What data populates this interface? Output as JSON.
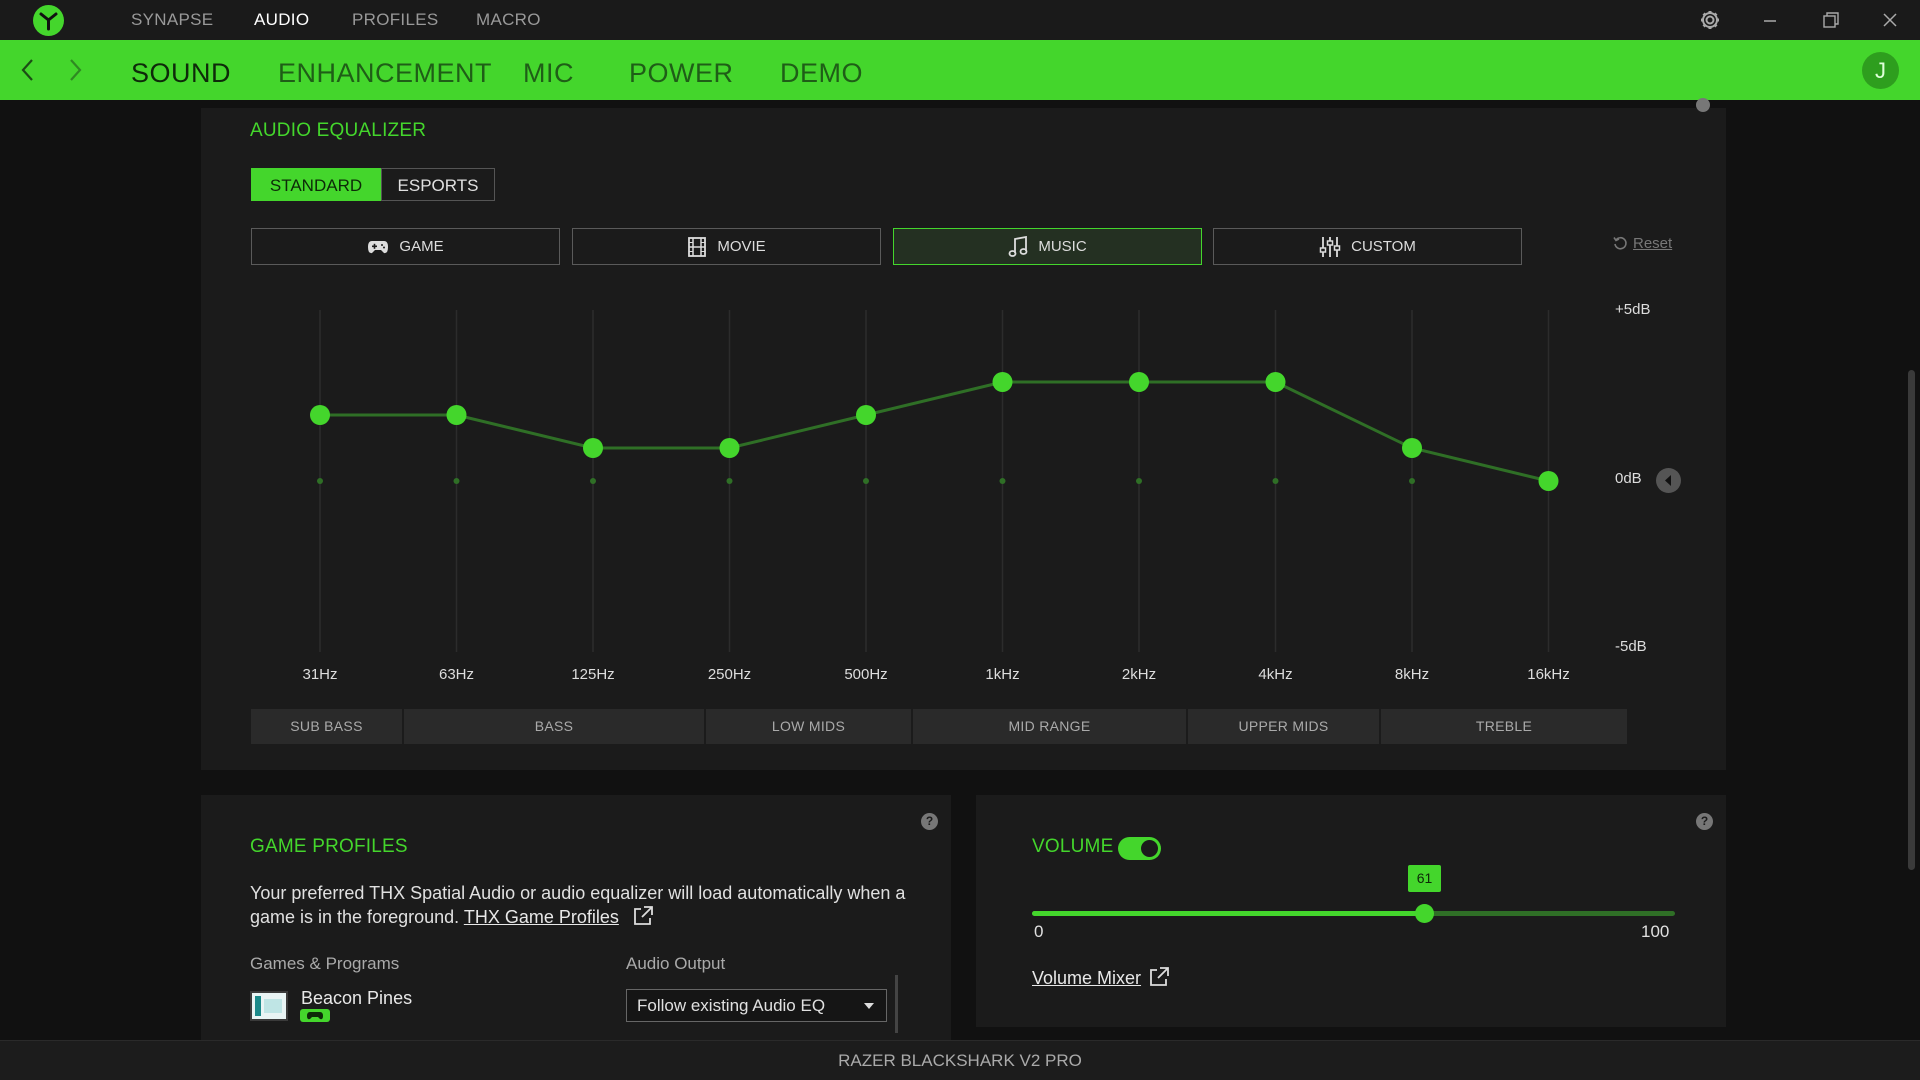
{
  "top_nav": [
    "SYNAPSE",
    "AUDIO",
    "PROFILES",
    "MACRO"
  ],
  "top_nav_active": "AUDIO",
  "tabs": [
    "SOUND",
    "ENHANCEMENT",
    "MIC",
    "POWER",
    "DEMO"
  ],
  "tabs_active": "SOUND",
  "user_initial": "J",
  "equalizer": {
    "title": "AUDIO EQUALIZER",
    "modes": [
      "STANDARD",
      "ESPORTS"
    ],
    "mode_active": "STANDARD",
    "presets": [
      {
        "label": "GAME",
        "icon": "gamepad-icon"
      },
      {
        "label": "MOVIE",
        "icon": "film-icon"
      },
      {
        "label": "MUSIC",
        "icon": "music-note-icon"
      },
      {
        "label": "CUSTOM",
        "icon": "sliders-icon"
      }
    ],
    "preset_active": "MUSIC",
    "reset_label": "Reset",
    "db_max_label": "+5dB",
    "db_mid_label": "0dB",
    "db_min_label": "-5dB",
    "bands": [
      {
        "freq": "31Hz",
        "gain": 2
      },
      {
        "freq": "63Hz",
        "gain": 2
      },
      {
        "freq": "125Hz",
        "gain": 1
      },
      {
        "freq": "250Hz",
        "gain": 1
      },
      {
        "freq": "500Hz",
        "gain": 2
      },
      {
        "freq": "1kHz",
        "gain": 3
      },
      {
        "freq": "2kHz",
        "gain": 3
      },
      {
        "freq": "4kHz",
        "gain": 3
      },
      {
        "freq": "8kHz",
        "gain": 1
      },
      {
        "freq": "16kHz",
        "gain": 0
      }
    ],
    "range_labels": [
      "SUB BASS",
      "BASS",
      "LOW MIDS",
      "MID RANGE",
      "UPPER MIDS",
      "TREBLE"
    ]
  },
  "game_profiles": {
    "title": "GAME PROFILES",
    "description": "Your preferred THX Spatial Audio or audio equalizer will load automatically when a game is in the foreground.",
    "link_label": "THX Game Profiles",
    "col_games": "Games & Programs",
    "col_output": "Audio Output",
    "game_name": "Beacon Pines",
    "output_value": "Follow existing Audio EQ"
  },
  "volume": {
    "title": "VOLUME",
    "enabled": true,
    "value": 61,
    "value_label": "61",
    "min_label": "0",
    "max_label": "100",
    "mixer_label": "Volume Mixer"
  },
  "device_name": "RAZER BLACKSHARK V2 PRO",
  "colors": {
    "accent": "#44d62c",
    "background": "#111111",
    "panel": "#1b1b1b"
  }
}
